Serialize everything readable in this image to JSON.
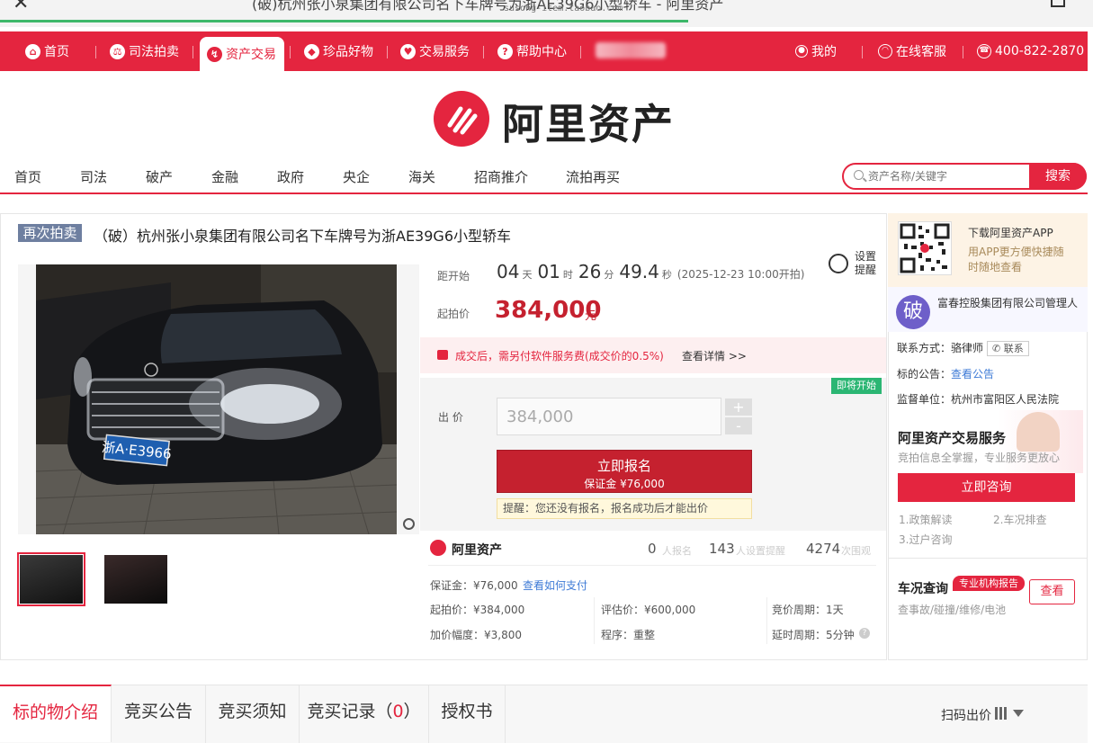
{
  "browser": {
    "page_title": "(破)杭州张小泉集团有限公司名下车牌号为浙AE39G6小型轿车 - 阿里资产",
    "url": "susong-item.taobao.com",
    "load_progress": 0.63
  },
  "topnav": {
    "items": [
      {
        "label": "首页",
        "icon": "home-icon"
      },
      {
        "label": "司法拍卖",
        "icon": "court-icon"
      },
      {
        "label": "资产交易",
        "icon": "asset-icon",
        "active": true
      },
      {
        "label": "珍品好物",
        "icon": "gem-icon"
      },
      {
        "label": "交易服务",
        "icon": "heart-icon"
      },
      {
        "label": "帮助中心",
        "icon": "help-icon"
      }
    ],
    "mine": "我的",
    "service": "在线客服",
    "phone": "400-822-2870"
  },
  "logo": {
    "text": "阿里资产"
  },
  "catnav": {
    "items": [
      "首页",
      "司法",
      "破产",
      "金融",
      "政府",
      "央企",
      "海关",
      "招商推介",
      "流拍再买"
    ]
  },
  "search": {
    "placeholder": "资产名称/关键字",
    "button": "搜索"
  },
  "item": {
    "badge": "再次拍卖",
    "title": "（破）杭州张小泉集团有限公司名下车牌号为浙AE39G6小型轿车",
    "plate": "浙A·E3966"
  },
  "countdown": {
    "label": "距开始",
    "days": "04",
    "days_unit": "天",
    "hours": "01",
    "hours_unit": "时",
    "minutes": "26",
    "minutes_unit": "分",
    "seconds": "49.4",
    "seconds_unit": "秒",
    "start_note": "(2025-12-23 10:00开拍)",
    "reminder": "设置提醒"
  },
  "price": {
    "label": "起拍价",
    "value": "384,000",
    "unit": "元"
  },
  "fee": {
    "text": "成交后，需另付软件服务费(成交价的0.5%)",
    "link": "查看详情 >>"
  },
  "bid": {
    "soon": "即将开始",
    "label": "出  价",
    "value": "384,000",
    "plus": "+",
    "minus": "-",
    "signup": "立即报名",
    "deposit": "保证金 ¥76,000",
    "tip": "提醒：您还没有报名，报名成功后才能出价"
  },
  "stats": {
    "brand": "阿里资产",
    "signups": "0",
    "signups_label": "人报名",
    "reminders": "143",
    "reminders_label": "人设置提醒",
    "views": "4274",
    "views_label": "次围观"
  },
  "info": {
    "deposit": "保证金：¥76,000",
    "pay_link": "查看如何支付",
    "start": "起拍价：¥384,000",
    "assess": "评估价：¥600,000",
    "cycle": "竞价周期：1天",
    "increment": "加价幅度：¥3,800",
    "procedure": "程序：重整",
    "delay": "延时周期：5分钟"
  },
  "side": {
    "app_title": "下载阿里资产APP",
    "app_desc": "用APP更方便快捷随时随地查看",
    "po": "破",
    "manager": "富春控股集团有限公司管理人",
    "contact_label": "联系方式：骆律师",
    "contact_btn": "联系",
    "notice_label": "标的公告：",
    "notice_link": "查看公告",
    "supervisor": "监督单位：杭州市富阳区人民法院",
    "banner_title": "阿里资产交易服务",
    "banner_sub": "竞拍信息全掌握，专业服务更放心",
    "consult": "立即咨询",
    "faq1": "1.政策解读",
    "faq2": "2.车况排查",
    "faq3": "3.过户咨询",
    "car_check": "车况查询",
    "agency": "专业机构报告",
    "car_desc": "查事故/碰撞/维修/电池",
    "check": "查看"
  },
  "tabs": {
    "intro": "标的物介绍",
    "notice": "竞买公告",
    "rules": "竞买须知",
    "record": "竞买记录（",
    "record_count": "0",
    "record_close": "）",
    "auth": "授权书",
    "scan": "扫码出价"
  },
  "colors": {
    "brand_red": "#e4253f",
    "price_red": "#c5212f",
    "badge_slate": "#6e7fa0",
    "green": "#2bb673"
  }
}
